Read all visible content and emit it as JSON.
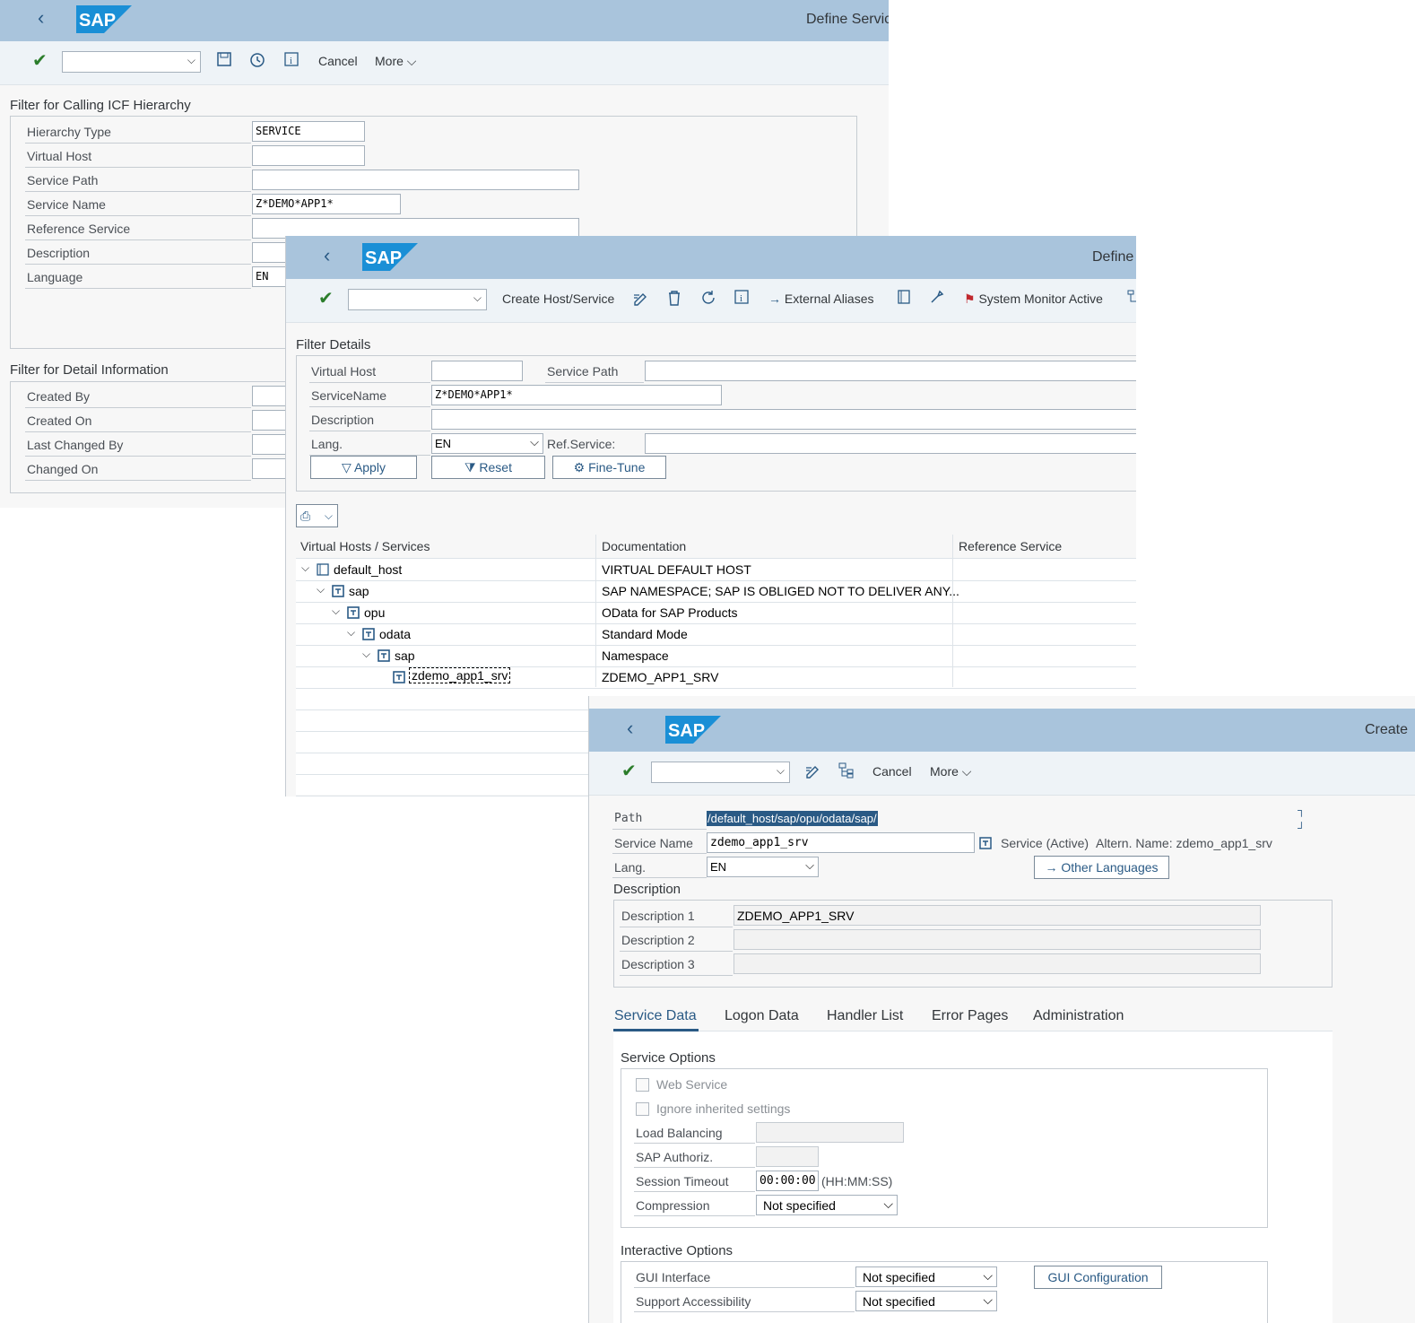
{
  "window1": {
    "title": "Define Servic",
    "toolbar": {
      "cancel_label": "Cancel",
      "more_label": "More"
    },
    "filter_hierarchy": {
      "heading": "Filter for Calling ICF Hierarchy",
      "fields": [
        {
          "label": "Hierarchy Type",
          "value": "SERVICE"
        },
        {
          "label": "Virtual Host",
          "value": ""
        },
        {
          "label": "Service Path",
          "value": ""
        },
        {
          "label": "Service Name",
          "value": "Z*DEMO*APP1*"
        },
        {
          "label": "Reference Service",
          "value": ""
        },
        {
          "label": "Description",
          "value": ""
        },
        {
          "label": "Language",
          "value": "EN"
        }
      ]
    },
    "filter_detail": {
      "heading": "Filter for Detail Information",
      "fields": [
        {
          "label": "Created By"
        },
        {
          "label": "Created On"
        },
        {
          "label": "Last Changed By"
        },
        {
          "label": "Changed On"
        }
      ]
    }
  },
  "window2": {
    "title": "Define",
    "toolbar": {
      "create_label": "Create Host/Service",
      "external_aliases_label": "External Aliases",
      "system_monitor_label": "System Monitor Active"
    },
    "filter_details": {
      "heading": "Filter Details",
      "virtual_host_label": "Virtual Host",
      "virtual_host_value": "",
      "service_path_label": "Service Path",
      "service_name_label": "ServiceName",
      "service_name_value": "Z*DEMO*APP1*",
      "description_label": "Description",
      "lang_label": "Lang.",
      "lang_value": "EN",
      "ref_service_label": "Ref.Service:",
      "apply_label": "Apply",
      "reset_label": "Reset",
      "finetune_label": "Fine-Tune"
    },
    "tree": {
      "columns": [
        "Virtual Hosts / Services",
        "Documentation",
        "Reference Service"
      ],
      "rows": [
        {
          "name": "default_host",
          "doc": "VIRTUAL DEFAULT HOST"
        },
        {
          "name": "sap",
          "doc": "SAP NAMESPACE; SAP IS OBLIGED NOT TO DELIVER ANY..."
        },
        {
          "name": "opu",
          "doc": "OData for SAP Products"
        },
        {
          "name": "odata",
          "doc": "Standard Mode"
        },
        {
          "name": "sap",
          "doc": "Namespace"
        },
        {
          "name": "zdemo_app1_srv",
          "doc": "ZDEMO_APP1_SRV"
        }
      ]
    }
  },
  "window3": {
    "title": "Create",
    "toolbar": {
      "cancel_label": "Cancel",
      "more_label": "More"
    },
    "path_label": "Path",
    "path_value": "/default_host/sap/opu/odata/sap/",
    "service_name_label": "Service Name",
    "service_name_value": "zdemo_app1_srv",
    "service_status": "Service (Active)",
    "altern_name": "Altern. Name: zdemo_app1_srv",
    "lang_label": "Lang.",
    "lang_value": "EN",
    "other_languages_label": "Other Languages",
    "description_heading": "Description",
    "descriptions": [
      {
        "label": "Description 1",
        "value": "ZDEMO_APP1_SRV"
      },
      {
        "label": "Description 2",
        "value": ""
      },
      {
        "label": "Description 3",
        "value": ""
      }
    ],
    "tabs": [
      "Service Data",
      "Logon Data",
      "Handler List",
      "Error Pages",
      "Administration"
    ],
    "service_options": {
      "heading": "Service Options",
      "web_service_label": "Web Service",
      "ignore_inherited_label": "Ignore inherited settings",
      "load_balancing_label": "Load Balancing",
      "sap_authoriz_label": "SAP Authoriz.",
      "session_timeout_label": "Session Timeout",
      "session_timeout_value": "00:00:00",
      "session_timeout_unit": "(HH:MM:SS)",
      "compression_label": "Compression",
      "compression_value": "Not specified"
    },
    "interactive_options": {
      "heading": "Interactive Options",
      "gui_interface_label": "GUI Interface",
      "gui_interface_value": "Not specified",
      "gui_configuration_label": "GUI Configuration",
      "support_accessibility_label": "Support Accessibility",
      "support_accessibility_value": "Not specified"
    }
  }
}
